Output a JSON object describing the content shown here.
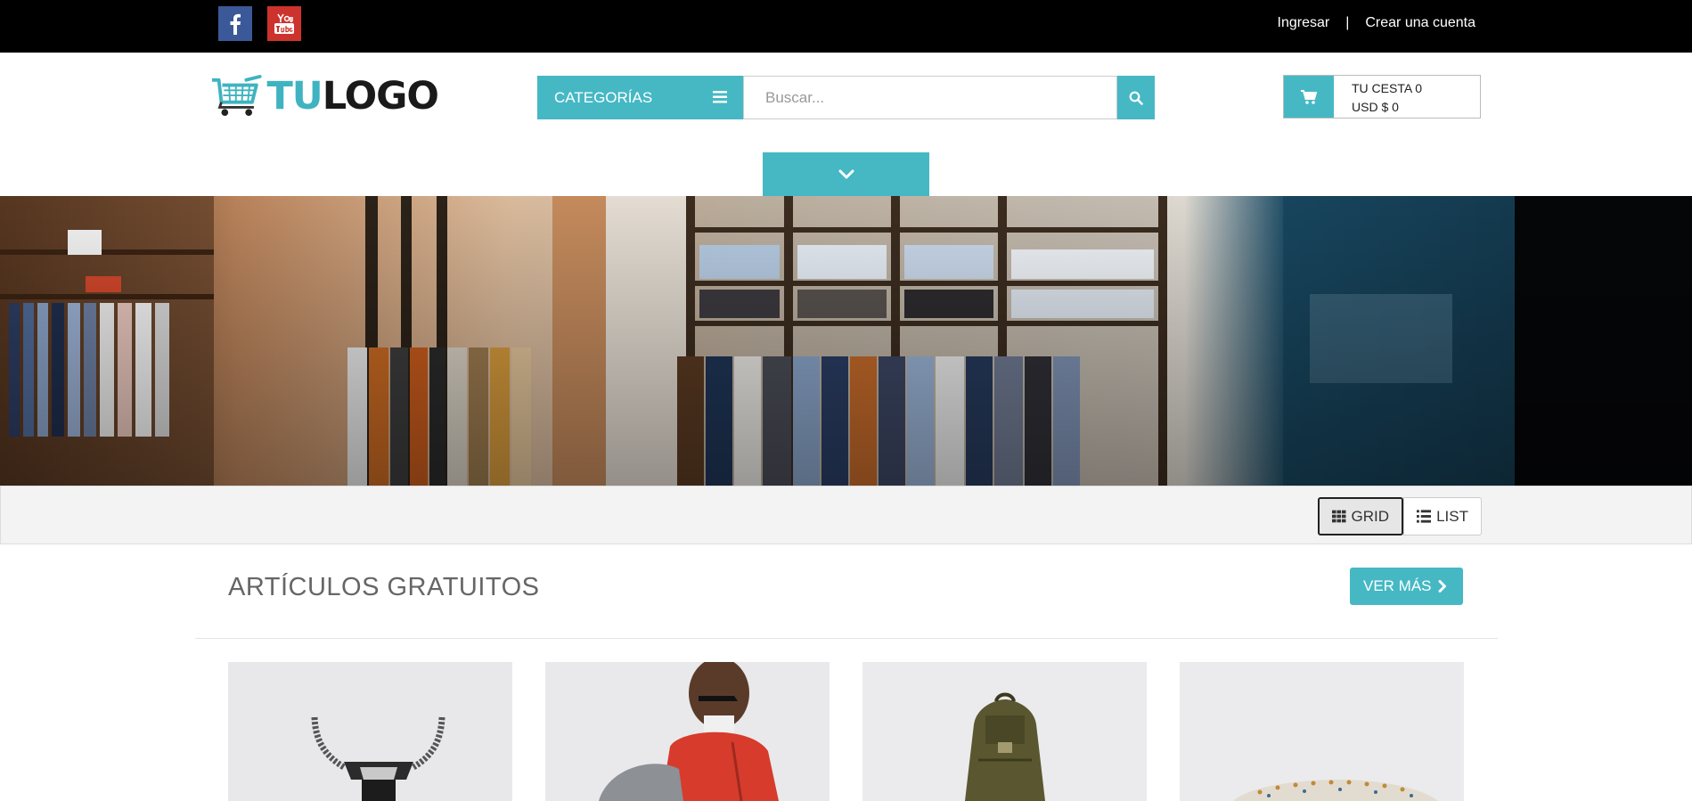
{
  "topbar": {
    "links": {
      "login": "Ingresar",
      "separator": "|",
      "register": "Crear una cuenta"
    },
    "social": {
      "facebook_icon": "facebook-icon",
      "youtube_icon": "youtube-icon"
    }
  },
  "header": {
    "logo": {
      "part1": "TU",
      "part2": "LOGO"
    },
    "categories_label": "CATEGORÍAS",
    "search_placeholder": "Buscar...",
    "cart": {
      "label": "TU CESTA 0",
      "total": "USD $ 0"
    }
  },
  "view_toggle": {
    "grid_label": "GRID",
    "list_label": "LIST",
    "active": "grid"
  },
  "section": {
    "title": "ARTÍCULOS GRATUITOS",
    "more_label": "VER MÁS"
  },
  "colors": {
    "accent": "#45b8c4",
    "topbar": "#000000",
    "facebook": "#3b5998",
    "youtube": "#cd332d"
  },
  "products": [
    {
      "image": "necklace-pendant"
    },
    {
      "image": "man-red-jacket-backpack"
    },
    {
      "image": "green-backpack"
    },
    {
      "image": "patterned-cap"
    }
  ]
}
